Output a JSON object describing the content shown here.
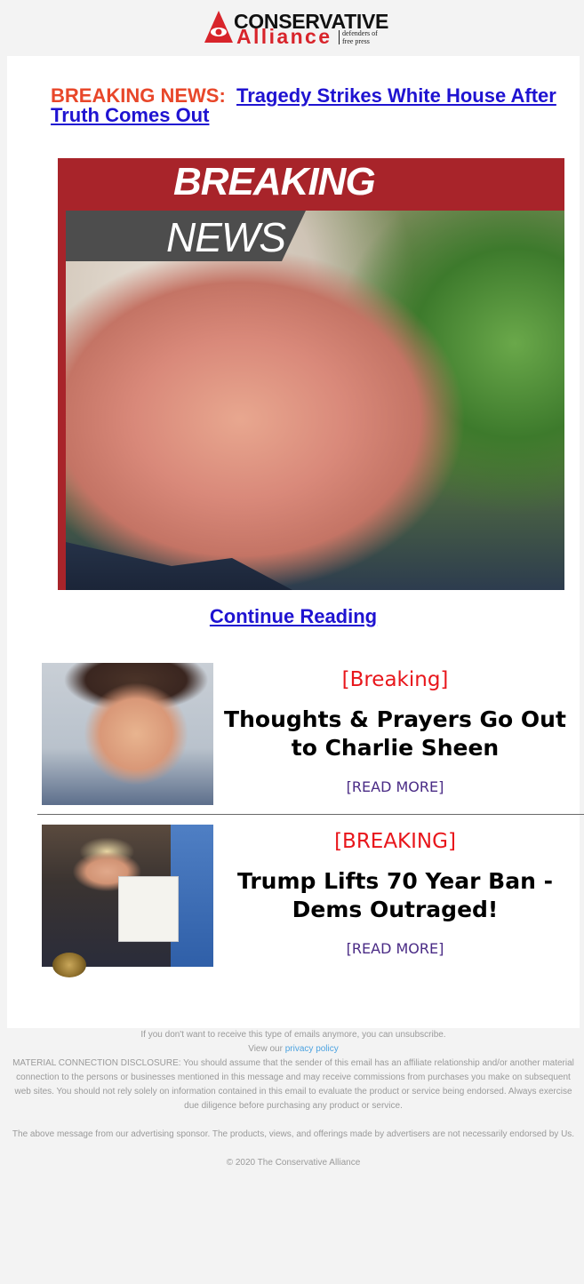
{
  "logo": {
    "line1": "CONSERVATIVE",
    "line2": "Alliance",
    "tagline": "defenders of free press"
  },
  "headline": {
    "prefix": "BREAKING NEWS:",
    "link_text": "Tragedy Strikes White House After Truth Comes Out"
  },
  "hero": {
    "banner_top": "BREAKING",
    "banner_bottom": "NEWS"
  },
  "continue_label": "Continue Reading",
  "stories": [
    {
      "kicker": "[Breaking]",
      "title": "Thoughts & Prayers Go Out to Charlie Sheen",
      "more": "[READ MORE]"
    },
    {
      "kicker": "[BREAKING]",
      "title": "Trump Lifts 70 Year Ban - Dems Outraged!",
      "more": "[READ MORE]"
    }
  ],
  "footer": {
    "unsubscribe": "If you don't want to receive this type of emails anymore, you can unsubscribe.",
    "view_our": "View our",
    "privacy_link": "privacy policy",
    "disclosure": "MATERIAL CONNECTION DISCLOSURE: You should assume that the sender of this email has an affiliate relationship and/or another material connection to the persons or businesses mentioned in this message and may receive commissions from purchases you make on subsequent web sites. You should not rely solely on information contained in this email to evaluate the product or service being endorsed. Always exercise due diligence before purchasing any product or service.",
    "sponsor_note": "The above message from our advertising sponsor. The products, views, and offerings made by advertisers are not necessarily endorsed by Us.",
    "copyright": "© 2020 The Conservative Alliance"
  }
}
